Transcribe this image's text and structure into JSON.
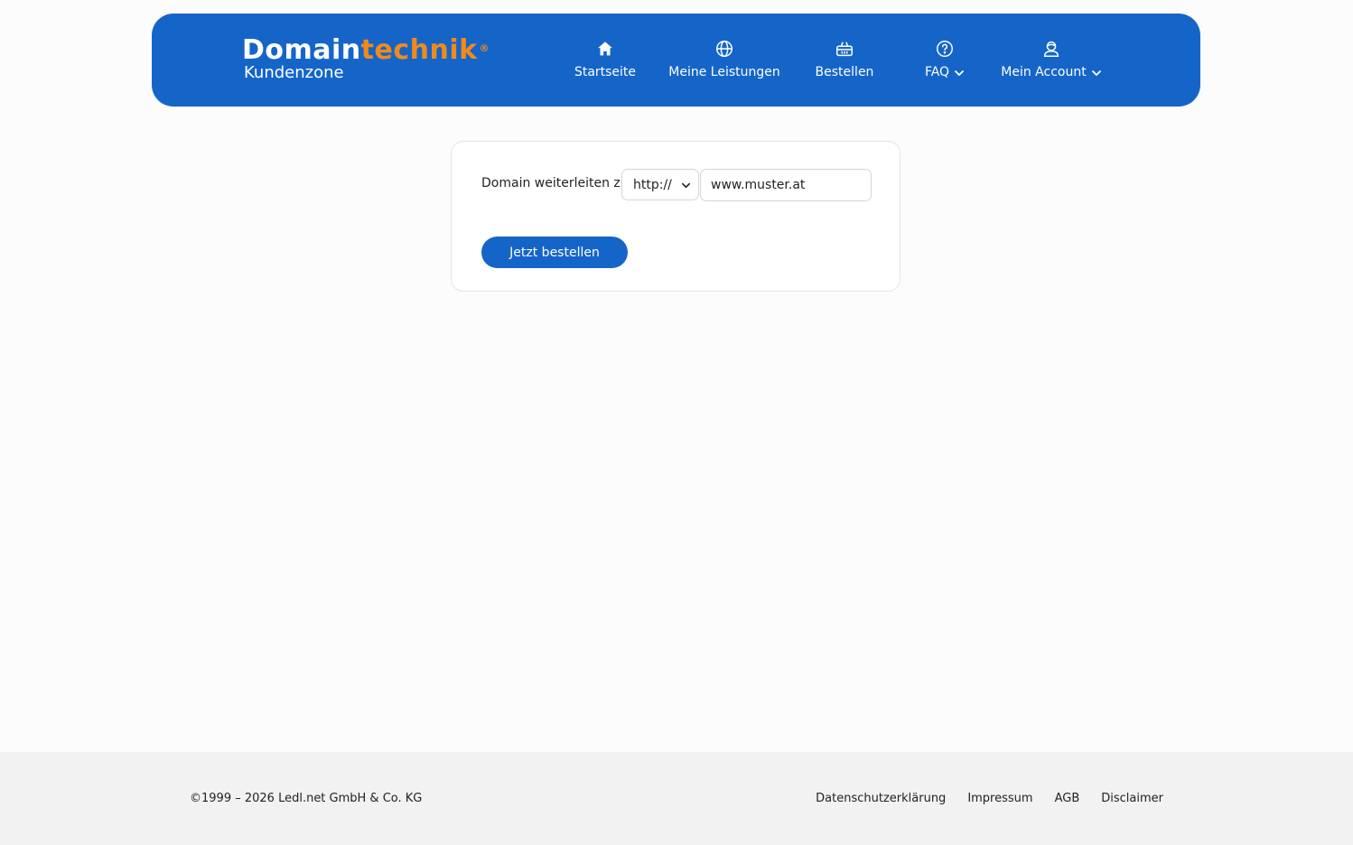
{
  "brand": {
    "name_part1": "Domain",
    "name_part2": "technik",
    "registered": "®",
    "subtitle": "Kundenzone",
    "accent_color": "#f08a1c",
    "primary_color": "#1565c8"
  },
  "nav": {
    "items": [
      {
        "label": "Startseite",
        "icon": "home-icon"
      },
      {
        "label": "Meine Leistungen",
        "icon": "globe-icon"
      },
      {
        "label": "Bestellen",
        "icon": "basket-icon"
      },
      {
        "label": "FAQ",
        "icon": "question-circle-icon",
        "dropdown": true
      },
      {
        "label": "Mein Account",
        "icon": "user-icon",
        "dropdown": true
      }
    ]
  },
  "form": {
    "label": "Domain weiterleiten zu:",
    "protocol_selected": "http://",
    "domain_value": "www.muster.at",
    "submit_label": "Jetzt bestellen"
  },
  "footer": {
    "copyright": "©1999 – 2026 Ledl.net GmbH & Co. KG",
    "links": [
      {
        "label": "Datenschutzerklärung"
      },
      {
        "label": "Impressum"
      },
      {
        "label": "AGB"
      },
      {
        "label": "Disclaimer"
      }
    ]
  }
}
